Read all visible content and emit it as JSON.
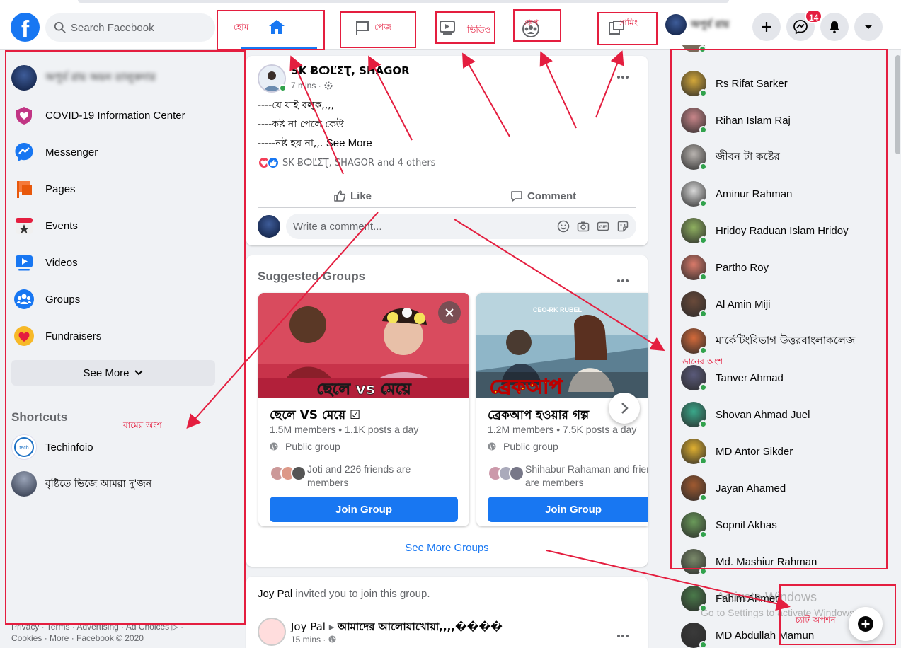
{
  "topbar": {
    "search_placeholder": "Search Facebook",
    "messenger_badge": "14",
    "tabs": {
      "home_label": "হোম",
      "pages_label": "পেজ",
      "video_label": "ভিডিও",
      "groups_label": "গ্রুপ",
      "gaming_label": "গেমিং"
    }
  },
  "sidebar": {
    "items": [
      {
        "label": "COVID-19 Information Center",
        "icon": "covid-info-icon"
      },
      {
        "label": "Messenger",
        "icon": "messenger-icon"
      },
      {
        "label": "Pages",
        "icon": "pages-flag-icon"
      },
      {
        "label": "Events",
        "icon": "events-calendar-icon"
      },
      {
        "label": "Videos",
        "icon": "video-play-icon"
      },
      {
        "label": "Groups",
        "icon": "groups-icon"
      },
      {
        "label": "Fundraisers",
        "icon": "fundraisers-heart-icon"
      }
    ],
    "see_more": "See More",
    "shortcuts_title": "Shortcuts",
    "shortcuts": [
      {
        "label": "Techinfoio"
      },
      {
        "label": "বৃষ্টিতে ভিজে আমরা দু'জন"
      }
    ],
    "footer_line1": "Privacy · Terms · Advertising · Ad Choices ▷ ·",
    "footer_line2": "Cookies · More · Facebook © 2020"
  },
  "post": {
    "author": "SK ɃѺĽΣƮ, SHAGOR",
    "time": "7 mins ·",
    "lines": [
      "----যে  যাই বলুক,,,,",
      "----কষ্ট না পেলে কেউ",
      "-----নষ্ট  হয় না,,. "
    ],
    "see_more": "See More",
    "reactions_text": "SK ɃѺĽΣƮ, SHAGOR and 4 others",
    "like_label": "Like",
    "comment_label": "Comment",
    "comment_placeholder": "Write a comment..."
  },
  "suggested_groups": {
    "title": "Suggested Groups",
    "groups": [
      {
        "name": "ছেলে VS মেয়ে ☑",
        "meta": "1.5M members • 1.1K posts a day",
        "privacy": "Public group",
        "friends": "Joti and 226 friends are members",
        "join": "Join Group"
      },
      {
        "name": "ব্রেকআপ হওয়ার গল্প",
        "meta": "1.2M members • 7.5K posts a day",
        "privacy": "Public group",
        "friends": "Shihabur Rahaman and friends are members",
        "join": "Join Group"
      }
    ],
    "see_more_groups": "See More Groups"
  },
  "invite": {
    "inviter": "Joy Pal",
    "text": " invited you to join this group.",
    "author": "Joy Pal",
    "group": "আমাদের আলোয়াখোয়া,,,,����",
    "time": "15 mins ·"
  },
  "contacts": [
    {
      "name": "Rs Rifat Sarker",
      "color": "#d4a83a"
    },
    {
      "name": "Rihan Islam Raj",
      "color": "#c9868a"
    },
    {
      "name": "জীবন টা কষ্টের",
      "color": "#b9b4b0"
    },
    {
      "name": "Aminur Rahman",
      "color": "#d8d8d8"
    },
    {
      "name": "Hridoy Raduan Islam Hridoy",
      "color": "#8fb060"
    },
    {
      "name": "Partho Roy",
      "color": "#d97a6a"
    },
    {
      "name": "Al Amin Miji",
      "color": "#6a4a3a"
    },
    {
      "name": "মার্কেটিংবিভাগ উত্তরবাংলাকলেজ",
      "color": "#d46a3a"
    },
    {
      "name": "Tanver Ahmad",
      "color": "#5a5a7a"
    },
    {
      "name": "Shovan Ahmad Juel",
      "color": "#3aa88a"
    },
    {
      "name": "MD Antor Sikder",
      "color": "#e0b030"
    },
    {
      "name": "Jayan Ahamed",
      "color": "#a05a30"
    },
    {
      "name": "Sopnil Akhas",
      "color": "#6a9a5a"
    },
    {
      "name": "Md. Mashiur Rahman",
      "color": "#7a8a6a"
    },
    {
      "name": "Fahim Ahmed",
      "color": "#4a7a4a"
    },
    {
      "name": "MD Abdullah Mamun",
      "color": "#3a3a3a"
    }
  ],
  "watermark": {
    "line1": "Activate Windows",
    "line2": "Go to Settings to activate Windows."
  },
  "annotations": {
    "left_section": "বামের অংশ",
    "right_section": "ডানের অংশ",
    "chat_option": "চ্যাট অপশন"
  },
  "colors": {
    "brand": "#1877f2",
    "annotation": "#e41e3f",
    "online": "#31a24c"
  }
}
